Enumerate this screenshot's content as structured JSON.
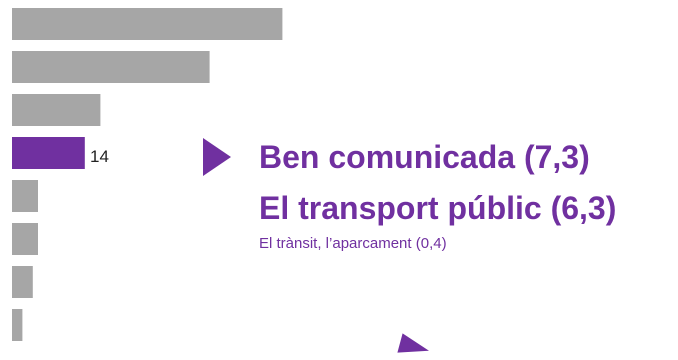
{
  "chart_data": {
    "type": "bar",
    "orientation": "horizontal",
    "values": [
      52,
      38,
      17,
      14,
      5,
      5,
      4,
      2
    ],
    "highlight_index": 3,
    "data_labels": [
      null,
      null,
      null,
      "14",
      null,
      null,
      null,
      null
    ],
    "colors": {
      "default": "#a6a6a6",
      "highlight": "#7030a0"
    }
  },
  "callout": {
    "headline": "Ben comunicada (7,3)",
    "subline": "El transport públic (6,3)",
    "minor": "El trànsit, l’aparcament (0,4)",
    "color": "#7030a0",
    "arrow_icon": "triangle-right-icon"
  }
}
